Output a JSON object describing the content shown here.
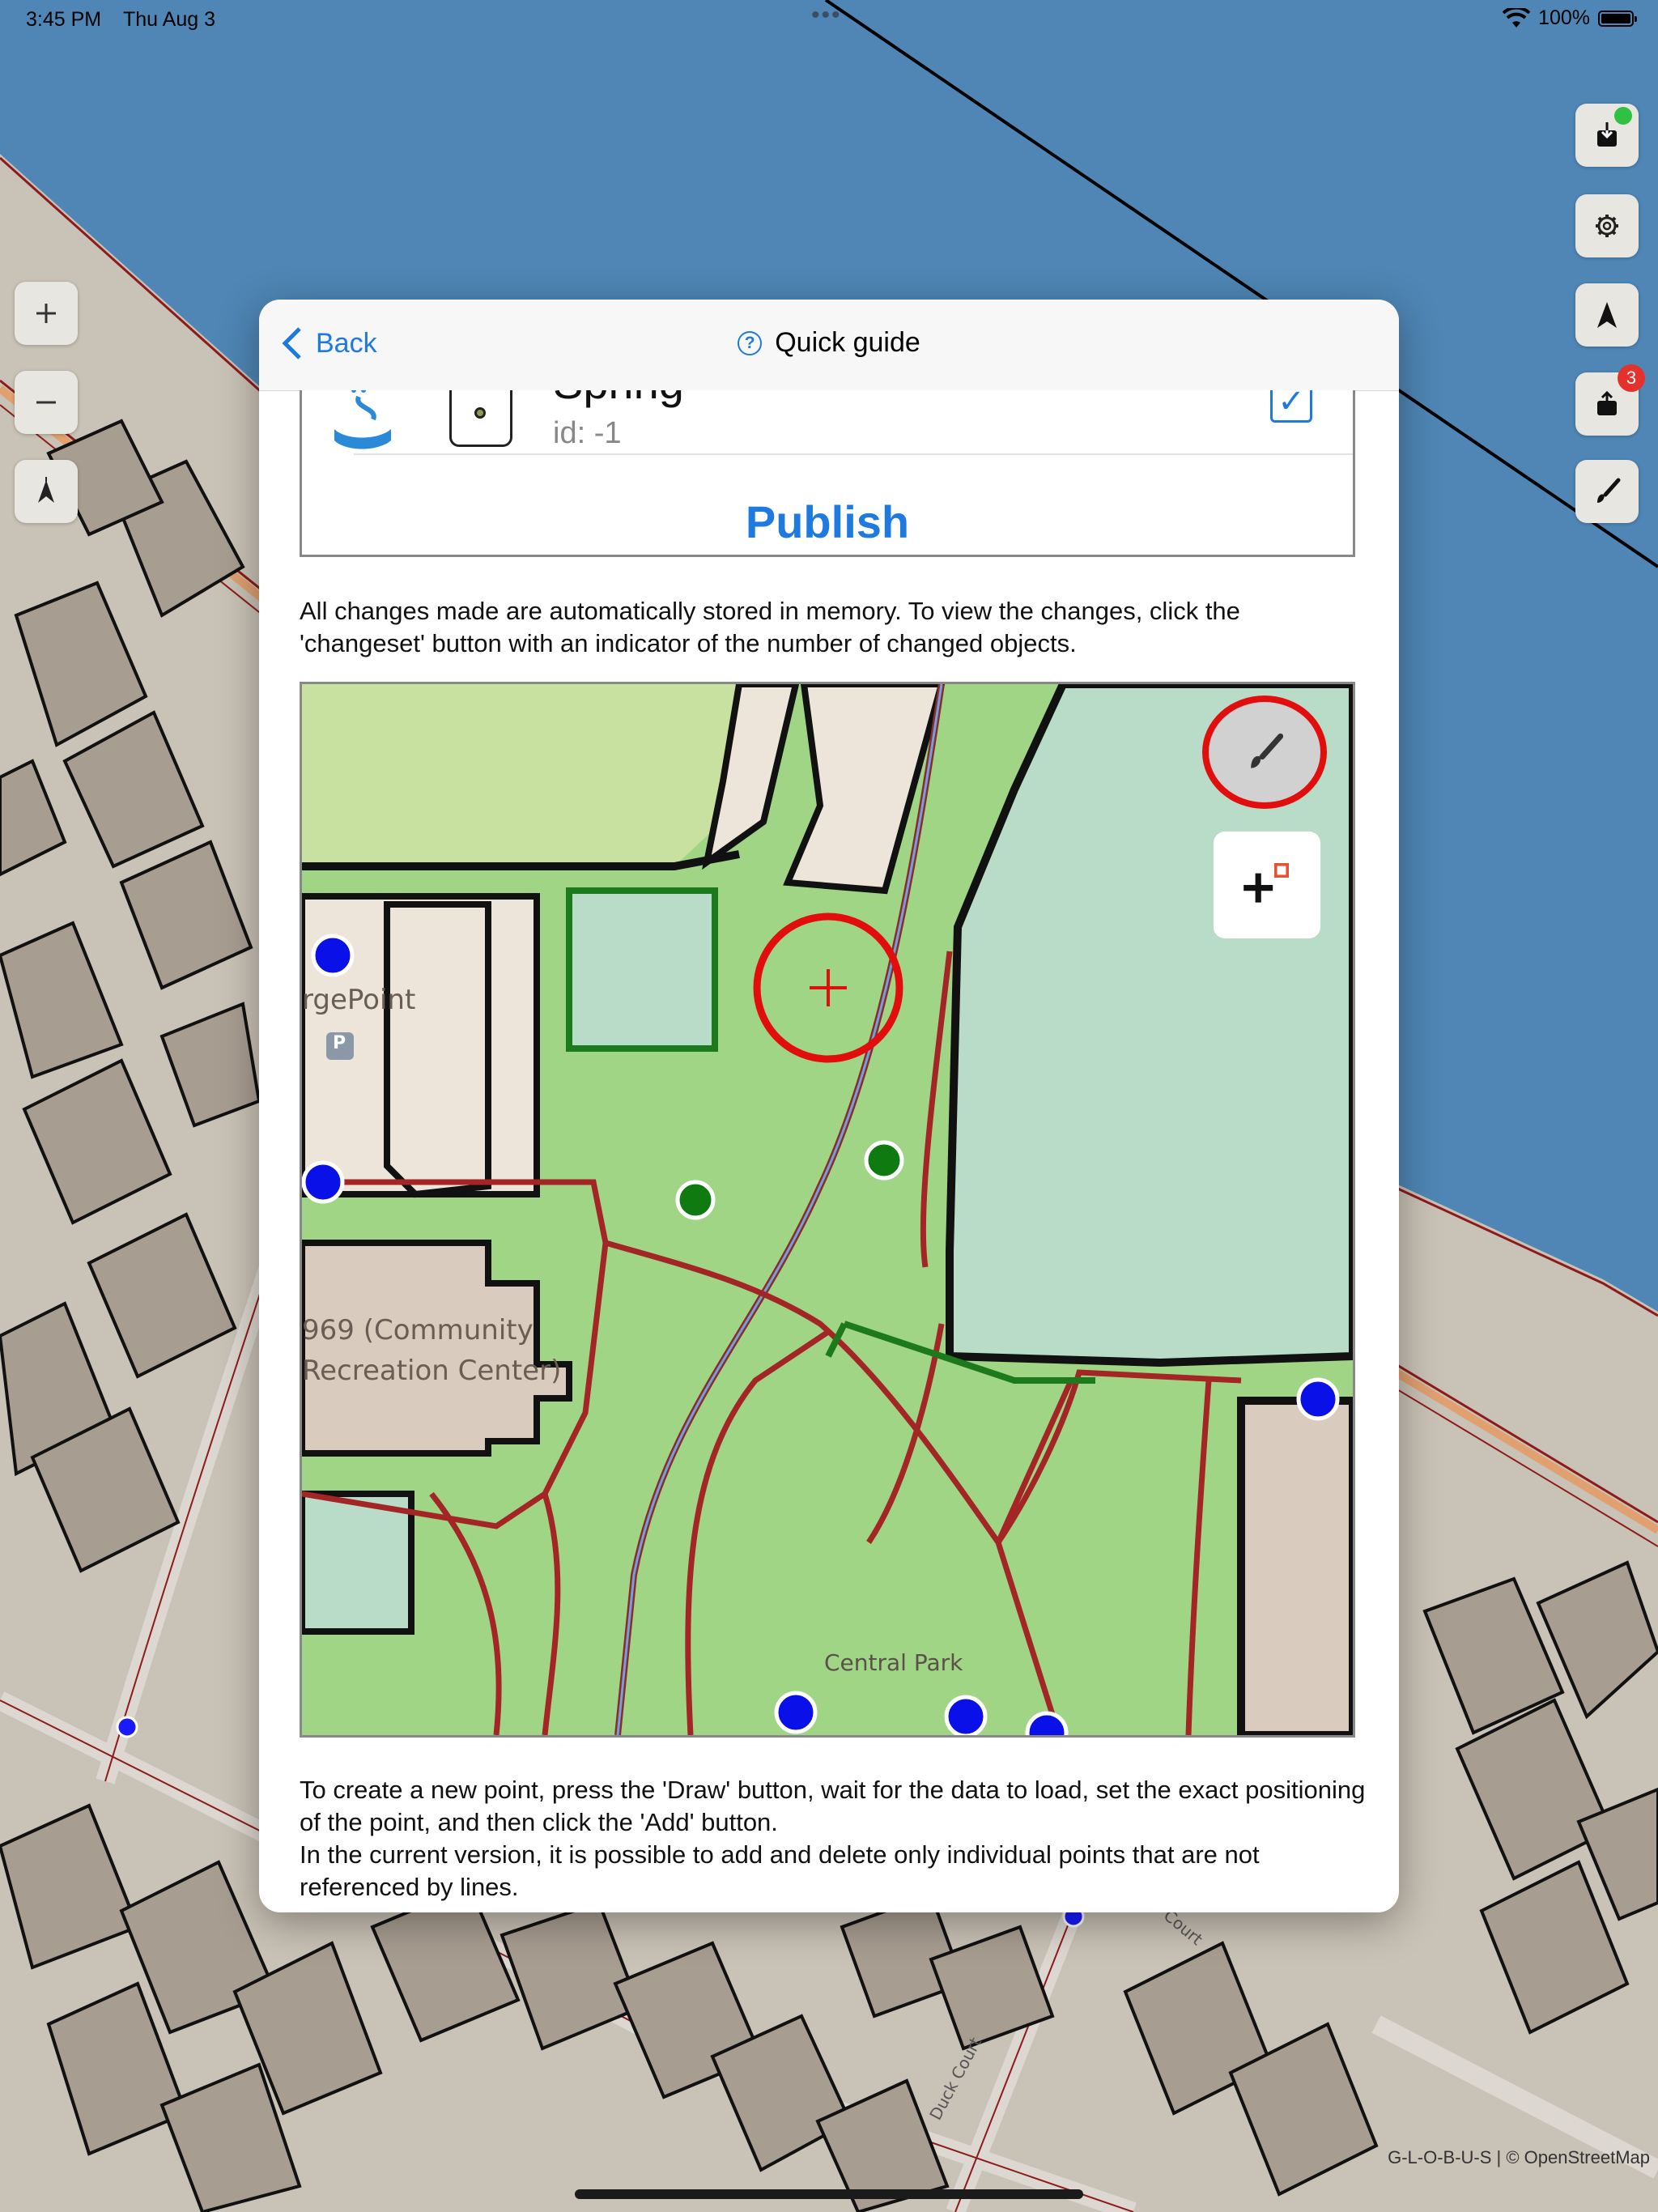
{
  "status_bar": {
    "time": "3:45 PM",
    "date": "Thu Aug 3",
    "battery": "100%"
  },
  "map": {
    "attribution": "G-L-O-B-U-S | © OpenStreetMap",
    "street_labels": [
      "Duck Court",
      "Court"
    ],
    "controls_left": [
      "zoom-in",
      "zoom-out",
      "compass"
    ],
    "controls_right": [
      "download",
      "settings",
      "location",
      "changeset",
      "draw"
    ],
    "changeset_badge": "3",
    "colors": {
      "water": "#4f86b5",
      "land": "#c9c2b6",
      "building": "#a89d91",
      "road_edge": "#8e1b1b",
      "accent": "#1f7ae0"
    }
  },
  "modal": {
    "back_label": "Back",
    "title": "Quick guide",
    "top_screenshot": {
      "feature_name": "Spring",
      "feature_id": "id: -1",
      "checked": true,
      "publish_label": "Publish"
    },
    "paragraph1": "All changes made are automatically stored in memory. To view the changes, click the 'changeset' button with an indicator of the number of changed objects.",
    "map_screenshot": {
      "labels": [
        "rgePoint",
        "969 (Community",
        "Recreation Center)",
        "Central Park"
      ],
      "parking_label": "P"
    },
    "paragraph2_line1": "To create a new point, press the 'Draw' button, wait for the data to load, set the exact positioning of the point, and then click the 'Add' button.",
    "paragraph2_line2": "In the current version, it is possible to add and delete only individual points that are not referenced by lines."
  }
}
